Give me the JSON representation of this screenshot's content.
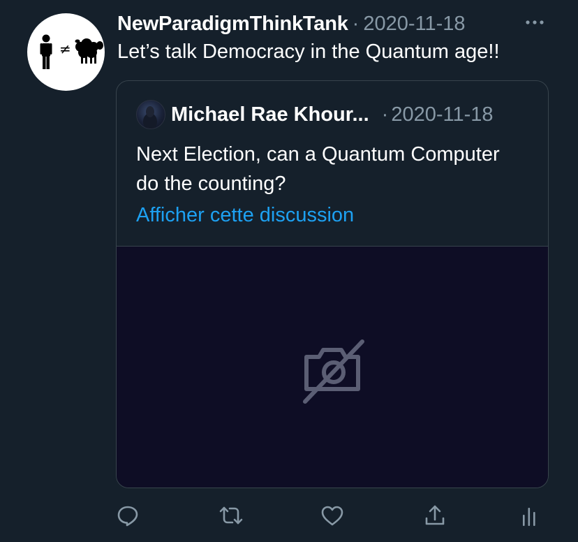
{
  "tweet": {
    "author_name": "NewParadigmThinkTank",
    "separator": "·",
    "date": "2020-11-18",
    "text": "Let’s talk Democracy in the Quantum age!!"
  },
  "avatar": {
    "icon": "person-not-equal-sheep-icon",
    "not_equal_symbol": "≠"
  },
  "quote": {
    "author_name": "Michael Rae Khour...",
    "separator": "·",
    "date": "2020-11-18",
    "text": "Next Election, can a Quantum Computer do the counting?",
    "link_label": "Afficher cette discussion",
    "media_icon": "media-unavailable-icon"
  },
  "actions": [
    {
      "icon": "reply-icon"
    },
    {
      "icon": "retweet-icon"
    },
    {
      "icon": "like-icon"
    },
    {
      "icon": "share-icon"
    },
    {
      "icon": "analytics-icon"
    }
  ],
  "colors": {
    "background": "#15202b",
    "secondary_text": "#8899a6",
    "link": "#1da1f2",
    "border": "#38444d",
    "media_background": "#0e0d25"
  }
}
